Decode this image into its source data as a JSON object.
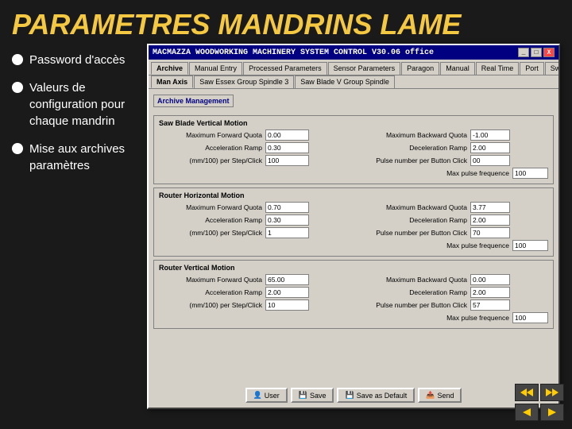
{
  "page": {
    "title": "PARAMETRES MANDRINS LAME",
    "background_color": "#1a1a1a"
  },
  "bullets": [
    {
      "id": "bullet-password",
      "text": "Password d'accès"
    },
    {
      "id": "bullet-valeurs",
      "text": "Valeurs de configuration pour chaque mandrin"
    },
    {
      "id": "bullet-archives",
      "text": "Mise aux archives paramètres"
    }
  ],
  "window": {
    "title": "MACMAZZA WOODWORKING MACHINERY SYSTEM CONTROL  V30.06 office",
    "controls": [
      "_",
      "□",
      "X"
    ],
    "tabs_row1": [
      "Archive",
      "Manual Entry",
      "Processed Parameters",
      "Sensor Parameters",
      "Paragon",
      "Manual",
      "Real Time",
      "Port",
      "Switch"
    ],
    "tabs_row2": [
      "Man Axis",
      "Saw Essex Group Spindle 3",
      "Saw Blade V Group Spindle"
    ],
    "active_tab_row1": "Archive",
    "sections": [
      {
        "id": "saw-blade-vertical",
        "title": "Saw Blade Vertical Motion",
        "rows": [
          {
            "left_label": "Maximum Forward Quota",
            "left_value": "0.00",
            "right_label": "Maximum Backward Quota",
            "right_value": "-1.00"
          },
          {
            "left_label": "Acceleration Ramp",
            "left_value": "0.30",
            "right_label": "Deceleration Ramp",
            "right_value": "2.00"
          },
          {
            "left_label": "(mm/100) per Step/Click",
            "left_value": "100",
            "right_label": "Pulse number per Button Click",
            "right_value": "00"
          }
        ],
        "extra_row": {
          "label": "Max pulse frequence",
          "value": "100"
        }
      },
      {
        "id": "router-horizontal",
        "title": "Router Horizontal Motion",
        "rows": [
          {
            "left_label": "Maximum Forward Quota",
            "left_value": "0.70",
            "right_label": "Maximum Backward Quota",
            "right_value": "3.77"
          },
          {
            "left_label": "Acceleration Ramp",
            "left_value": "0.30",
            "right_label": "Deceleration Ramp",
            "right_value": "2.00"
          },
          {
            "left_label": "(mm/100) per Step/Click",
            "left_value": "1",
            "right_label": "Pulse number per Button Click",
            "right_value": "70"
          }
        ],
        "extra_row": {
          "label": "Max pulse frequence",
          "value": "100"
        }
      },
      {
        "id": "router-vertical",
        "title": "Router Vertical Motion",
        "rows": [
          {
            "left_label": "Maximum Forward Quota",
            "left_value": "65.00",
            "right_label": "Maximum Backward Quota",
            "right_value": "0.00"
          },
          {
            "left_label": "Acceleration Ramp",
            "left_value": "2.00",
            "right_label": "Deceleration Ramp",
            "right_value": "2.00"
          },
          {
            "left_label": "(mm/100) per Step/Click",
            "left_value": "10",
            "right_label": "Pulse number per Button Click",
            "right_value": "57"
          }
        ],
        "extra_row": {
          "label": "Max pulse frequence",
          "value": "100"
        }
      }
    ],
    "archive_section_label": "Archive Management",
    "buttons": [
      {
        "id": "btn-user",
        "icon": "👤",
        "label": "User"
      },
      {
        "id": "btn-save",
        "icon": "💾",
        "label": "Save"
      },
      {
        "id": "btn-save-default",
        "icon": "💾",
        "label": "Save as Default"
      },
      {
        "id": "btn-send",
        "icon": "📤",
        "label": "Send"
      }
    ]
  }
}
